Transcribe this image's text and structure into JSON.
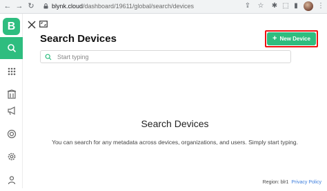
{
  "browser": {
    "url_host": "blynk.cloud",
    "url_path": "/dashboard/19611/global/search/devices",
    "nav_icons": [
      "arrow-left-icon",
      "arrow-right-icon",
      "reload-icon"
    ],
    "toolbar_icons": [
      "share-icon",
      "star-icon",
      "extension-icon",
      "sidebar-icon",
      "menu-icon"
    ]
  },
  "app": {
    "logo_letter": "B",
    "brand_color": "#2ebd7f",
    "sidebar": [
      {
        "name": "search",
        "icon": "search-icon",
        "active": true
      },
      {
        "name": "apps",
        "icon": "grid-icon",
        "active": false
      },
      {
        "name": "organizations",
        "icon": "building-icon",
        "active": false
      },
      {
        "name": "announcements",
        "icon": "megaphone-icon",
        "active": false
      },
      {
        "name": "support",
        "icon": "lifebuoy-icon",
        "active": false
      },
      {
        "name": "settings",
        "icon": "gear-icon",
        "active": false
      },
      {
        "name": "profile",
        "icon": "user-icon",
        "active": false
      }
    ]
  },
  "main": {
    "title": "Search Devices",
    "new_device_label": "New Device",
    "search_placeholder": "Start typing",
    "empty_title": "Search Devices",
    "empty_description": "You can search for any metadata across devices, organizations, and users. Simply start typing."
  },
  "footer": {
    "region": "Region: blr1",
    "privacy": "Privacy Policy"
  }
}
